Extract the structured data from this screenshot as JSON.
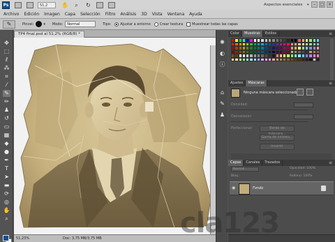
{
  "app": {
    "logo": "Ps",
    "zoom": "51,2",
    "workspace": "Aspectos esenciales",
    "workspace_arrow": "▾",
    "window_controls": [
      "–",
      "□",
      "×"
    ],
    "icons": [
      "mini-bridge-icon",
      "view-extras-icon",
      "hand-icon",
      "zoom-icon",
      "rotate-view-icon",
      "arrange-documents-icon",
      "screen-mode-icon"
    ]
  },
  "menu": [
    "Archivo",
    "Edición",
    "Imagen",
    "Capa",
    "Selección",
    "Filtro",
    "Análisis",
    "3D",
    "Vista",
    "Ventana",
    "Ayuda"
  ],
  "options": {
    "brush_label": "Pincel:",
    "mode_label": "Modo:",
    "mode_value": "Normal",
    "type_label": "Tipo:",
    "type_option_1": "Ajustar a entorno",
    "type_option_2": "Crear textura",
    "sample_all": "Muestrear todas las capas"
  },
  "document": {
    "title": "TP4 final.psd al 51,2% (RGB/8) *",
    "zoom_status": "51,23%",
    "doc_info": "Doc: 3,75 MB/3,75 MB"
  },
  "panels": {
    "swatches_tabs": [
      "Color",
      "Muestras",
      "Estilos"
    ],
    "swatches_active": 1,
    "masks_tabs": [
      "Ajustes",
      "Máscaras"
    ],
    "masks_active": 1,
    "masks_status": "Ninguna máscara seleccionada",
    "masks_fields": [
      "Densidad:",
      "Desvanecer:"
    ],
    "masks_refine": "Perfeccionar:",
    "masks_buttons": [
      "Borde de máscara...",
      "Gama de colores...",
      "Invertir"
    ],
    "layers_tabs": [
      "Capas",
      "Canales",
      "Trazados"
    ],
    "layers_active": 0,
    "blend_mode": "Normal",
    "opacity": "Opacidad: 100%",
    "fill": "Relleno: 100%",
    "lock_label": "Bloq.:",
    "layer_name": "Fondo"
  },
  "colors": {
    "foreground": "#0c4e9e",
    "background": "#ffffff",
    "swatch_rows": [
      [
        "#ff0000",
        "#ffff00",
        "#00ff00",
        "#00ffff",
        "#0000ff",
        "#ff00ff",
        "#ffffff",
        "#f2f2f2",
        "#d9d9d9",
        "#bfbfbf",
        "#a6a6a6",
        "#8c8c8c",
        "#737373",
        "#595959",
        "#404040",
        "#262626",
        "#0d0d0d",
        "#000000",
        "#ff5a5a",
        "#ffad5a",
        "#fff05a",
        "#8cff5a",
        "#5affad",
        "#5ad7ff"
      ],
      [
        "#ed1c24",
        "#f26522",
        "#f7941d",
        "#fff200",
        "#8dc63f",
        "#39b54a",
        "#00a651",
        "#00a99d",
        "#00aeef",
        "#0072bc",
        "#0054a6",
        "#2e3192",
        "#662d91",
        "#92278f",
        "#ec008c",
        "#ed145b",
        "#f69679",
        "#f9ad81",
        "#fdc68a",
        "#fff799",
        "#c4df9b",
        "#a3d39c",
        "#82ca9d",
        "#7accc8"
      ],
      [
        "#9e0b0f",
        "#a0410d",
        "#a36209",
        "#aba000",
        "#598527",
        "#1a7b30",
        "#007236",
        "#00746b",
        "#0076a3",
        "#004a80",
        "#003471",
        "#1b1464",
        "#440e62",
        "#630460",
        "#9e005d",
        "#9e0039",
        "#f7977a",
        "#fbaf5d",
        "#fff568",
        "#a2d39c",
        "#6dcff6",
        "#8393ca",
        "#a187be",
        "#f49ac1"
      ],
      [
        "#790000",
        "#7b2e00",
        "#7d4900",
        "#827b00",
        "#406618",
        "#005e20",
        "#005826",
        "#005952",
        "#005b7f",
        "#003663",
        "#002157",
        "#0d004c",
        "#32004b",
        "#4b0049",
        "#7b0046",
        "#7a0026",
        "#c7b299",
        "#998675",
        "#736357",
        "#534741",
        "#37302d",
        "#c69c6d",
        "#a67c52",
        "#8c6239"
      ],
      [
        "#754c24",
        "#603913",
        "#ffffff",
        "#e6e6e6",
        "#cccccc",
        "#b3b3b3",
        "#999999",
        "#808080",
        "#666666",
        "#4d4d4d",
        "#333333",
        "#1a1a1a",
        "#ff8080",
        "#ffbf80",
        "#ffff80",
        "#bfff80",
        "#80ff80",
        "#80ffbf",
        "#80ffff",
        "#80bfff",
        "#8080ff",
        "#bf80ff",
        "#ff80ff",
        "#ff80bf"
      ],
      [
        "#ffd5aa",
        "#ffeeaa",
        "#ddffaa",
        "#aaffaa",
        "#aaffdd",
        "#aaffff",
        "#aaddff",
        "#aaaaff",
        "#ddaaff",
        "#ffaaff",
        "#ffaadd",
        "#ffaaaa",
        "#c8a064",
        "#b48c50",
        "#a0783c",
        "#8c6428",
        "#785014",
        "#643c00",
        "#503000",
        "#3c2400",
        "#281800",
        "#140c00",
        "#e0e0e0",
        "#202020"
      ]
    ]
  }
}
